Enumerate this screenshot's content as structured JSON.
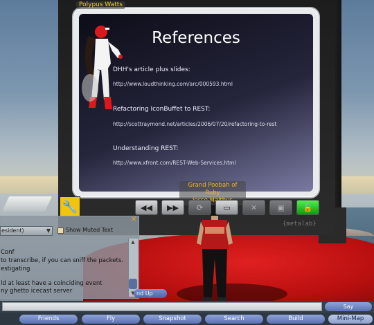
{
  "scene": {
    "name_tags": {
      "polypus": "Polypus Watts",
      "poobah_line1": "Grand Poobah of Ruby",
      "poobah_line2": "Jesse Malthus"
    },
    "board_brand": "{metalab}"
  },
  "slide": {
    "title": "References",
    "items": [
      {
        "label": "DHH's article plus slides:",
        "url": "http://www.loudthinking.com/arc/000593.html"
      },
      {
        "label": "Refactoring IconBuffet to REST:",
        "url": "http://scottraymond.net/articles/2006/07/20/refactoring-to-rest"
      },
      {
        "label": "Understanding REST:",
        "url": "http://www.xfront.com/REST-Web-Services.html"
      }
    ]
  },
  "controls": {
    "icons": [
      "rewind-icon",
      "fast-forward-icon",
      "refresh-icon",
      "slide-icon",
      "shuffle-icon",
      "camera-icon",
      "lock-icon"
    ],
    "glyphs": [
      "◀◀",
      "▶▶",
      "⟳",
      "▭",
      "✕",
      "▣",
      "🔓"
    ]
  },
  "chat": {
    "close_glyph": "✕",
    "channel_value": "esident)",
    "show_muted_label": "Show Muted Text",
    "lines": [
      "Conf",
      "to transcribe, if you can sniff the packets.",
      "estigating",
      "",
      "ld at least have a coinciding event",
      "ny ghetto icecast server"
    ],
    "stand_up_label": "nd Up"
  },
  "bottom": {
    "say_label": "Say",
    "toolbar": [
      {
        "label": "Friends",
        "selected": false
      },
      {
        "label": "Fly",
        "selected": false
      },
      {
        "label": "Snapshot",
        "selected": false
      },
      {
        "label": "Search",
        "selected": false
      },
      {
        "label": "Build",
        "selected": false
      },
      {
        "label": "Mini-Map",
        "selected": true
      }
    ]
  },
  "colors": {
    "name_tag": "#f5d020",
    "button_blue": "#5b72b6",
    "active_green": "#1fc41f"
  }
}
